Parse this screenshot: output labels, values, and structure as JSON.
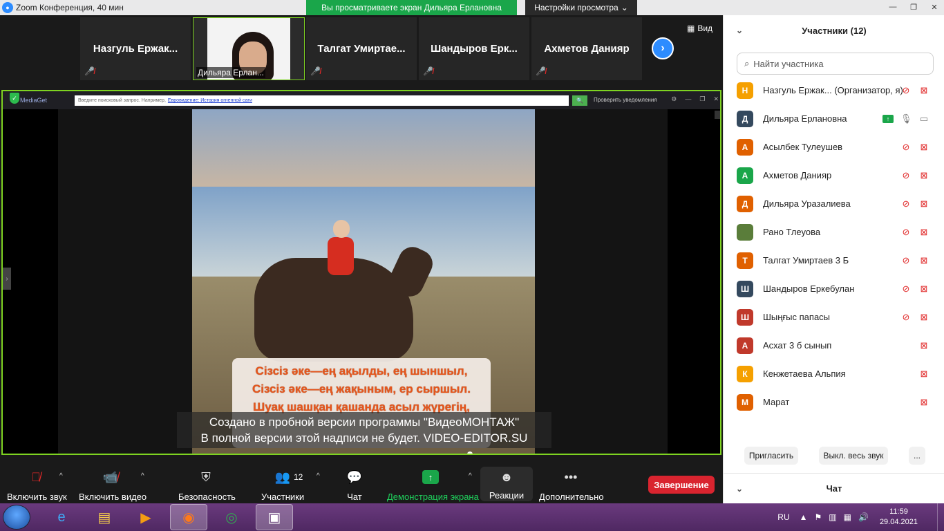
{
  "window": {
    "title": "Zoom Конференция, 40 мин",
    "share_banner": "Вы просматриваете экран Дильяра Ерлановна",
    "view_settings": "Настройки просмотра",
    "view_btn": "Вид"
  },
  "video_strip": [
    {
      "name": "Назгуль  Ержак..."
    },
    {
      "name": "Дильяра Ерлан..."
    },
    {
      "name": "Талгат  Умиртае..."
    },
    {
      "name": "Шандыров  Ерк..."
    },
    {
      "name": "Ахметов Данияр"
    }
  ],
  "shared_screen": {
    "app_name": "MediaGet",
    "search_placeholder": "Введите поисковый запрос. Например,",
    "search_link": "Евровидение: История огненной саги",
    "notify_label": "Проверить уведомления",
    "lyrics": [
      "Сізсіз әке—ең ақылды, ең шыншыл,",
      "Сізсіз әке—ең жақыным, ер сыршыл.",
      "Шуақ шашқан қашанда асыл жүрегің,"
    ],
    "watermark_line1": "Создано в пробной версии программы \"ВидеоМОНТАЖ\"",
    "watermark_line2": "В полной версии этой надписи не будет. VIDEO-EDITOR.SU",
    "progress": 0.645
  },
  "toolbar": {
    "audio": "Включить звук",
    "video": "Включить видео",
    "security": "Безопасность",
    "participants": "Участники",
    "participants_count": "12",
    "chat": "Чат",
    "share": "Демонстрация экрана",
    "reactions": "Реакции",
    "more": "Дополнительно",
    "end": "Завершение"
  },
  "panel": {
    "title": "Участники (12)",
    "search_placeholder": "Найти участника",
    "participants": [
      {
        "initial": "Н",
        "name": "Назгуль Ержак... (Организатор, я)",
        "color": "#f5a000",
        "mic": "off",
        "cam": "off",
        "share": false
      },
      {
        "initial": "Д",
        "name": "Дильяра Ерлановна",
        "color": "#34495e",
        "mic": "on",
        "cam": "on",
        "share": true
      },
      {
        "initial": "А",
        "name": "Асылбек Тулеушев",
        "color": "#e06000",
        "mic": "off",
        "cam": "off",
        "share": false
      },
      {
        "initial": "А",
        "name": "Ахметов Данияр",
        "color": "#1aa64a",
        "mic": "off",
        "cam": "off",
        "share": false
      },
      {
        "initial": "Д",
        "name": "Дильяра Уразалиева",
        "color": "#e06000",
        "mic": "off",
        "cam": "off",
        "share": false
      },
      {
        "initial": "",
        "name": "Рано Тлеуова",
        "color": "#5a7d3a",
        "mic": "off",
        "cam": "off",
        "share": false
      },
      {
        "initial": "Т",
        "name": "Талгат Умиртаев 3 Б",
        "color": "#e06000",
        "mic": "off",
        "cam": "off",
        "share": false
      },
      {
        "initial": "Ш",
        "name": "Шандыров Еркебулан",
        "color": "#34495e",
        "mic": "off",
        "cam": "off",
        "share": false
      },
      {
        "initial": "Ш",
        "name": "Шыңғыс папасы",
        "color": "#c0392b",
        "mic": "off",
        "cam": "off",
        "share": false
      },
      {
        "initial": "А",
        "name": "Асхат 3 б сынып",
        "color": "#c0392b",
        "mic": "none",
        "cam": "off",
        "share": false
      },
      {
        "initial": "К",
        "name": "Кенжетаева Альпия",
        "color": "#f5a000",
        "mic": "none",
        "cam": "off",
        "share": false
      },
      {
        "initial": "М",
        "name": "Марат",
        "color": "#e06000",
        "mic": "none",
        "cam": "off",
        "share": false
      }
    ],
    "invite": "Пригласить",
    "mute_all": "Выкл. весь звук",
    "more": "...",
    "chat_title": "Чат"
  },
  "taskbar": {
    "lang": "RU",
    "time": "11:59",
    "date": "29.04.2021"
  },
  "colors": {
    "accent": "#2d8cff",
    "share_green": "#1aa64a",
    "end_red": "#d9242f",
    "active_border": "#7ed321"
  }
}
